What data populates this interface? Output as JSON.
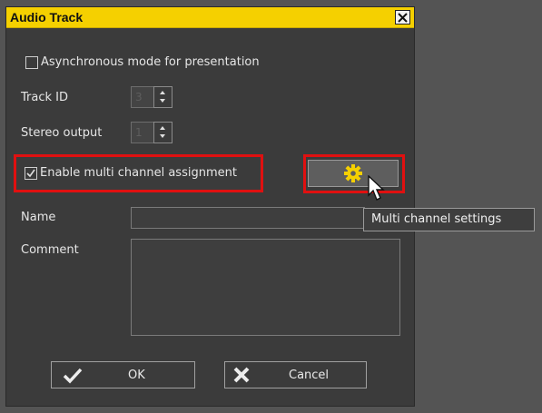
{
  "window": {
    "title": "Audio Track",
    "close_icon": "close-icon"
  },
  "options": {
    "async_label": "Asynchronous mode for presentation",
    "async_checked": false,
    "track_id_label": "Track ID",
    "track_id_value": "3",
    "stereo_output_label": "Stereo output",
    "stereo_output_value": "1",
    "multi_channel_label": "Enable multi channel assignment",
    "multi_channel_checked": true
  },
  "settings_button": {
    "icon": "gear-icon",
    "tooltip": "Multi channel settings"
  },
  "fields": {
    "name_label": "Name",
    "name_value": "",
    "comment_label": "Comment",
    "comment_value": ""
  },
  "footer": {
    "ok_label": "OK",
    "ok_icon": "checkmark-icon",
    "cancel_label": "Cancel",
    "cancel_icon": "x-icon"
  },
  "colors": {
    "title_bar": "#f5d000",
    "highlight": "#e01010",
    "gear": "#f5d000",
    "dialog_bg": "#3b3b3b"
  }
}
